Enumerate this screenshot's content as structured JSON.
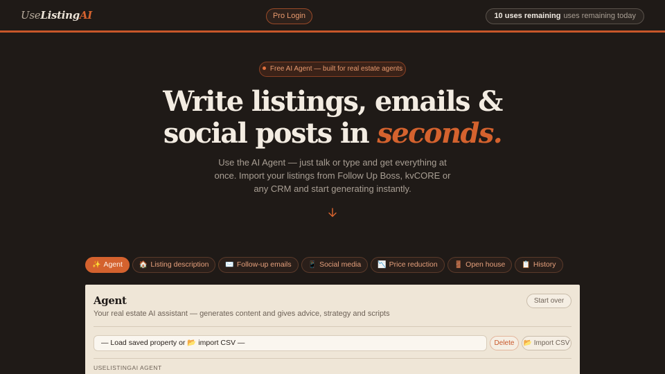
{
  "header": {
    "logo": {
      "part1": "Use",
      "part2": "Listing",
      "part3": "AI"
    },
    "pro_login": "Pro Login",
    "uses": {
      "count_text": "10 uses remaining",
      "suffix_text": "uses remaining today"
    }
  },
  "hero": {
    "badge": "Free AI Agent — built for real estate agents",
    "title_line1": "Write listings, emails &",
    "title_line2_prefix": "social posts in ",
    "title_line2_accent": "seconds.",
    "subtitle": "Use the AI Agent — just talk or type and get everything at once. Import your listings from Follow Up Boss, kvCORE or any CRM and start generating instantly."
  },
  "tabs": [
    {
      "icon": "✨",
      "label": "Agent",
      "active": true
    },
    {
      "icon": "🏠",
      "label": "Listing description"
    },
    {
      "icon": "✉️",
      "label": "Follow-up emails"
    },
    {
      "icon": "📱",
      "label": "Social media"
    },
    {
      "icon": "📉",
      "label": "Price reduction"
    },
    {
      "icon": "🚪",
      "label": "Open house"
    },
    {
      "icon": "📋",
      "label": "History"
    }
  ],
  "panel": {
    "title": "Agent",
    "description": "Your real estate AI assistant — generates content and gives advice, strategy and scripts",
    "start_over": "Start over",
    "select_value": "— Load saved property or 📂 import CSV —",
    "delete": "Delete",
    "import_csv": "📂 Import CSV",
    "agent_label": "USELISTINGAI AGENT"
  },
  "colors": {
    "accent": "#d4622e",
    "background": "#1f1a17",
    "panel": "#efe6d7"
  }
}
